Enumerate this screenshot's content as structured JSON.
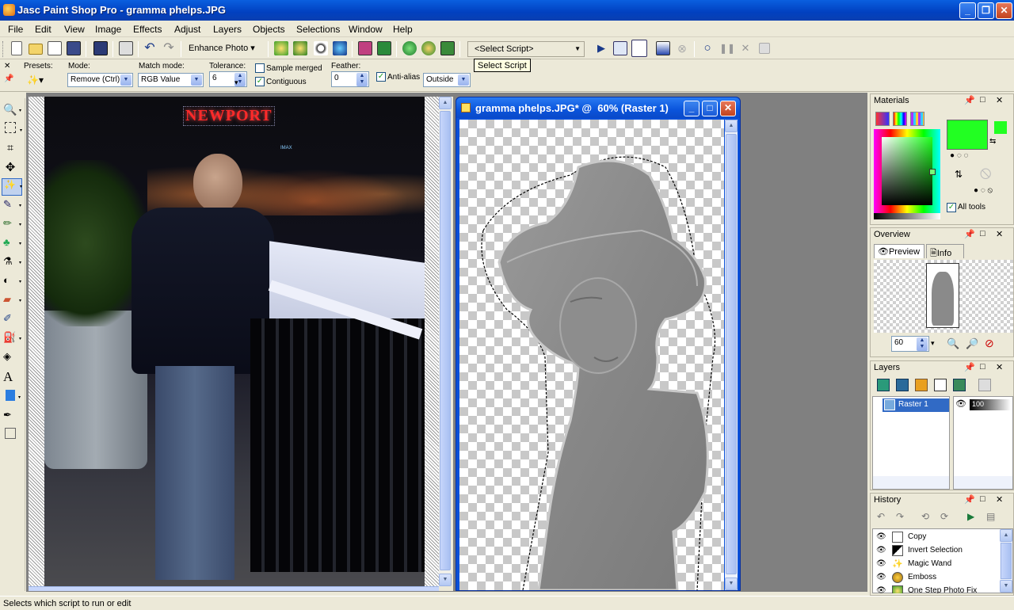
{
  "app": {
    "title": "Jasc Paint Shop Pro - gramma phelps.JPG"
  },
  "menu": [
    "File",
    "Edit",
    "View",
    "Image",
    "Effects",
    "Adjust",
    "Layers",
    "Objects",
    "Selections",
    "Window",
    "Help"
  ],
  "toolbar": {
    "enhance_photo_label": "Enhance Photo",
    "script_select_value": "<Select Script>",
    "tooltip": "Select Script"
  },
  "options": {
    "presets_label": "Presets:",
    "mode_label": "Mode:",
    "mode_value": "Remove (Ctrl)",
    "match_mode_label": "Match mode:",
    "match_mode_value": "RGB Value",
    "tolerance_label": "Tolerance:",
    "tolerance_value": "6",
    "sample_merged_label": "Sample merged",
    "contiguous_label": "Contiguous",
    "feather_label": "Feather:",
    "feather_value": "0",
    "antialias_label": "Anti-alias",
    "outside_value": "Outside"
  },
  "doc_window": {
    "title": "gramma phelps.JPG* @  60% (Raster 1)"
  },
  "photo": {
    "sign_text": "NEWPORT",
    "imax_text": "IMAX"
  },
  "materials": {
    "title": "Materials",
    "all_tools_label": "All tools",
    "foreground_color": "#22ff22"
  },
  "overview": {
    "title": "Overview",
    "tab_preview": "Preview",
    "tab_info": "Info",
    "zoom_value": "60"
  },
  "layers": {
    "title": "Layers",
    "layer_name": "Raster 1",
    "opacity": "100"
  },
  "history": {
    "title": "History",
    "items": [
      "Copy",
      "Invert Selection",
      "Magic Wand",
      "Emboss",
      "One Step Photo Fix"
    ]
  },
  "status": {
    "text": "Selects which script to run or edit"
  }
}
